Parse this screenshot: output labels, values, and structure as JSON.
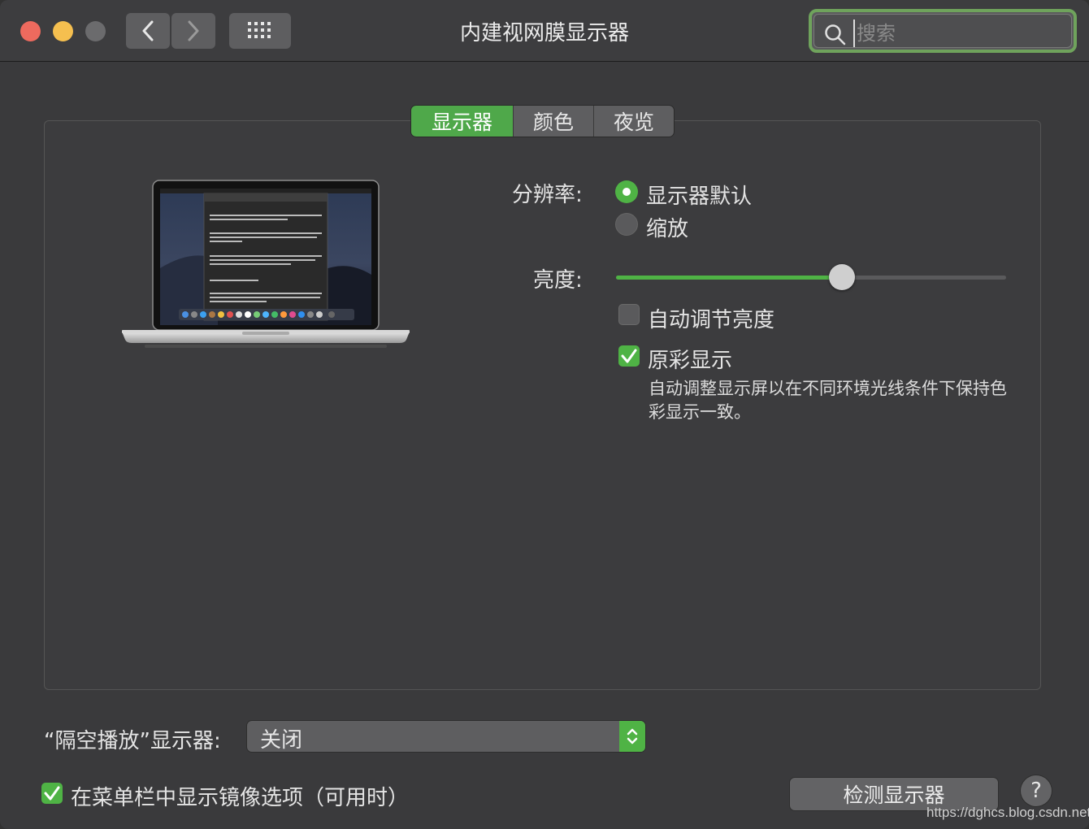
{
  "window": {
    "title": "内建视网膜显示器"
  },
  "search": {
    "placeholder": "搜索"
  },
  "tabs": [
    {
      "label": "显示器",
      "active": true
    },
    {
      "label": "颜色",
      "active": false
    },
    {
      "label": "夜览",
      "active": false
    }
  ],
  "resolution": {
    "label": "分辨率:",
    "options": [
      {
        "label": "显示器默认",
        "selected": true
      },
      {
        "label": "缩放",
        "selected": false
      }
    ]
  },
  "brightness": {
    "label": "亮度:",
    "value_fraction": 0.58
  },
  "auto_brightness": {
    "label": "自动调节亮度",
    "checked": false
  },
  "true_tone": {
    "label": "原彩显示",
    "checked": true,
    "description": "自动调整显示屏以在不同环境光线条件下保持色彩显示一致。"
  },
  "airplay": {
    "label": "“隔空播放”显示器:",
    "selected_value": "关闭"
  },
  "mirror_menu": {
    "label": "在菜单栏中显示镜像选项（可用时）",
    "checked": true
  },
  "detect_button": "检测显示器",
  "help_symbol": "?",
  "watermark": "https://dghcs.blog.csdn.net",
  "colors": {
    "accent": "#4fb345",
    "window_bg": "#3a3a3c",
    "close": "#ed6a5e",
    "minimize": "#f5bf4f"
  },
  "icons": [
    "close-icon",
    "minimize-icon",
    "zoom-icon",
    "chevron-left-icon",
    "chevron-right-icon",
    "grid-icon",
    "search-icon",
    "laptop-image",
    "checkmark-icon",
    "updown-arrows-icon"
  ]
}
